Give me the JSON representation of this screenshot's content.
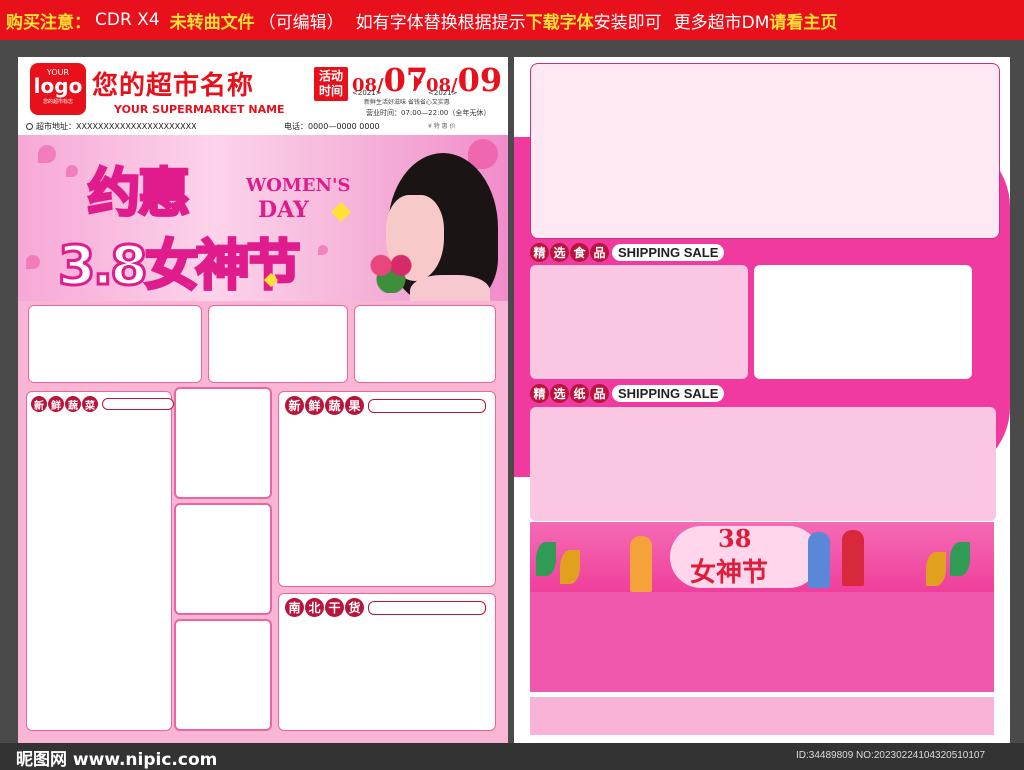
{
  "topbar": {
    "p1": "购买注意：",
    "p2": "CDR X4",
    "p3": "未转曲文件",
    "p4": "（可编辑）",
    "p5": "如有字体替换根据提示",
    "p6": "下载字体",
    "p7": "安装即可",
    "p8": "更多超市DM",
    "p9": "请看主页"
  },
  "header": {
    "logo_top": "YOUR",
    "logo_main": "logo",
    "logo_sub": "您的超市标志",
    "shop_name": "您的超市名称",
    "shop_name_en": "YOUR SUPERMARKET NAME",
    "activity_label_1": "活动",
    "activity_label_2": "时间",
    "start_month": "08/",
    "start_day": "07",
    "start_year": "<2021>",
    "end_month": "08/",
    "end_day": "09",
    "end_year": "<2021>",
    "slogan": "新鲜生活好滋味  省钱省心又实惠",
    "hours": "营业时间：07:00—22:00（全年无休）",
    "address": "超市地址：XXXXXXXXXXXXXXXXXXXXXX",
    "phone": "电话：0000—0000 0000",
    "small_text": "¥ 特 惠 价"
  },
  "banner": {
    "title_line1": "约惠",
    "title_line2": "3.8女神节",
    "women": "WOMEN'S",
    "day": "DAY"
  },
  "left_sections": {
    "fresh_veg": [
      "新",
      "鲜",
      "蔬",
      "菜"
    ],
    "fresh_fruit": [
      "新",
      "鲜",
      "蔬",
      "果"
    ],
    "dry_goods": [
      "南",
      "北",
      "干",
      "货"
    ]
  },
  "right_sections": {
    "food_tag": [
      "精",
      "选",
      "食",
      "品"
    ],
    "food_label": "SHIPPING SALE",
    "paper_tag": [
      "精",
      "选",
      "纸",
      "品"
    ],
    "paper_label": "SHIPPING SALE",
    "banner_38": "38",
    "banner_title": "女神节"
  },
  "footer": {
    "site": "昵图网 www.nipic.com",
    "id": "ID:34489809 NO:20230224104320510107"
  },
  "colors": {
    "brand_red": "#e8101a",
    "pink": "#f03aa0",
    "light_pink": "#f8b6d4",
    "tag_red": "#b8143c"
  }
}
